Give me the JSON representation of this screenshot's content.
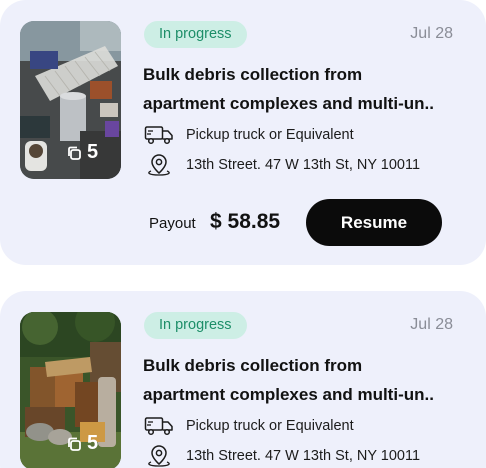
{
  "jobs": [
    {
      "status": "In progress",
      "date": "Jul 28",
      "title_line1": "Bulk debris collection from",
      "title_line2": "apartment complexes and multi-un..",
      "photo_count": "5",
      "vehicle": "Pickup truck or Equivalent",
      "address": "13th Street. 47 W 13th St, NY 10011",
      "payout_label": "Payout",
      "payout_value": "$ 58.85",
      "action_label": "Resume"
    },
    {
      "status": "In progress",
      "date": "Jul 28",
      "title_line1": "Bulk debris collection from",
      "title_line2": "apartment complexes and multi-un..",
      "photo_count": "5",
      "vehicle": "Pickup truck or Equivalent",
      "address": "13th Street. 47 W 13th St, NY 10011"
    }
  ],
  "icons": {
    "vehicle": "truck-icon",
    "address": "location-pin-icon",
    "photos": "copy-icon"
  },
  "colors": {
    "card_background": "#eef0fb",
    "status_pill_background": "#cdeee5",
    "status_pill_text": "#1d8e68",
    "button_background": "#0b0b0b",
    "button_text": "#ffffff"
  }
}
